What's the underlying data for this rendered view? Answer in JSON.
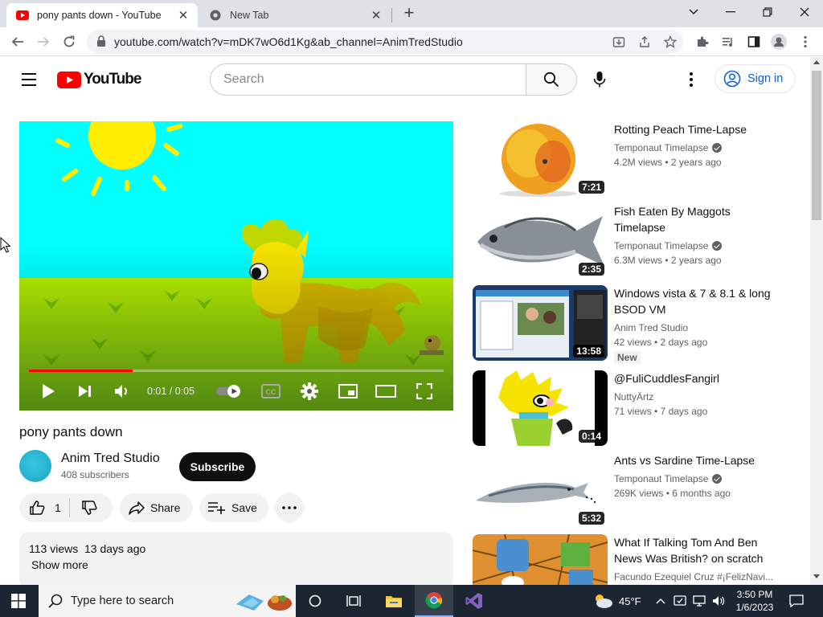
{
  "browser": {
    "tabs": [
      {
        "title": "pony pants down - YouTube",
        "active": true
      },
      {
        "title": "New Tab",
        "active": false
      }
    ],
    "url": "youtube.com/watch?v=mDK7wO6d1Kg&ab_channel=AnimTredStudio"
  },
  "header": {
    "logo_text": "YouTube",
    "search_placeholder": "Search",
    "sign_in": "Sign in"
  },
  "player": {
    "time": "0:01 / 0:05",
    "progress": 0.25
  },
  "video": {
    "title": "pony pants down",
    "channel": "Anim Tred Studio",
    "subscribers": "408 subscribers",
    "subscribe_label": "Subscribe",
    "likes": "1",
    "share_label": "Share",
    "save_label": "Save",
    "description_meta": "113 views  13 days ago",
    "show_more": "Show more"
  },
  "recommendations": [
    {
      "title": "Rotting Peach Time-Lapse",
      "channel": "Temponaut Timelapse",
      "verified": true,
      "meta": "4.2M views • 2 years ago",
      "duration": "7:21"
    },
    {
      "title": "Fish Eaten By Maggots Timelapse",
      "channel": "Temponaut Timelapse",
      "verified": true,
      "meta": "6.3M views • 2 years ago",
      "duration": "2:35"
    },
    {
      "title": "Windows vista & 7 & 8.1 & long BSOD VM",
      "channel": "Anim Tred Studio",
      "verified": false,
      "meta": "42 views • 2 days ago",
      "badge": "New",
      "duration": "13:58"
    },
    {
      "title": "@FuliCuddlesFangirl",
      "channel": "NuttyÄrtz",
      "verified": false,
      "meta": "71 views • 7 days ago",
      "duration": "0:14"
    },
    {
      "title": "Ants vs Sardine Time-Lapse",
      "channel": "Temponaut Timelapse",
      "verified": true,
      "meta": "269K views • 6 months ago",
      "duration": "5:32"
    },
    {
      "title": "What If Talking Tom And Ben News Was British? on scratch",
      "channel": "Facundo Ezequiel Cruz #¡FelizNavi...",
      "verified": false,
      "meta": "",
      "duration": ""
    }
  ],
  "taskbar": {
    "search_placeholder": "Type here to search",
    "weather": "45°F",
    "time": "3:50 PM",
    "date": "1/6/2023"
  },
  "colors": {
    "youtube_red": "#ff0000",
    "link_blue": "#065fd4",
    "taskbar": "#1c2532"
  }
}
